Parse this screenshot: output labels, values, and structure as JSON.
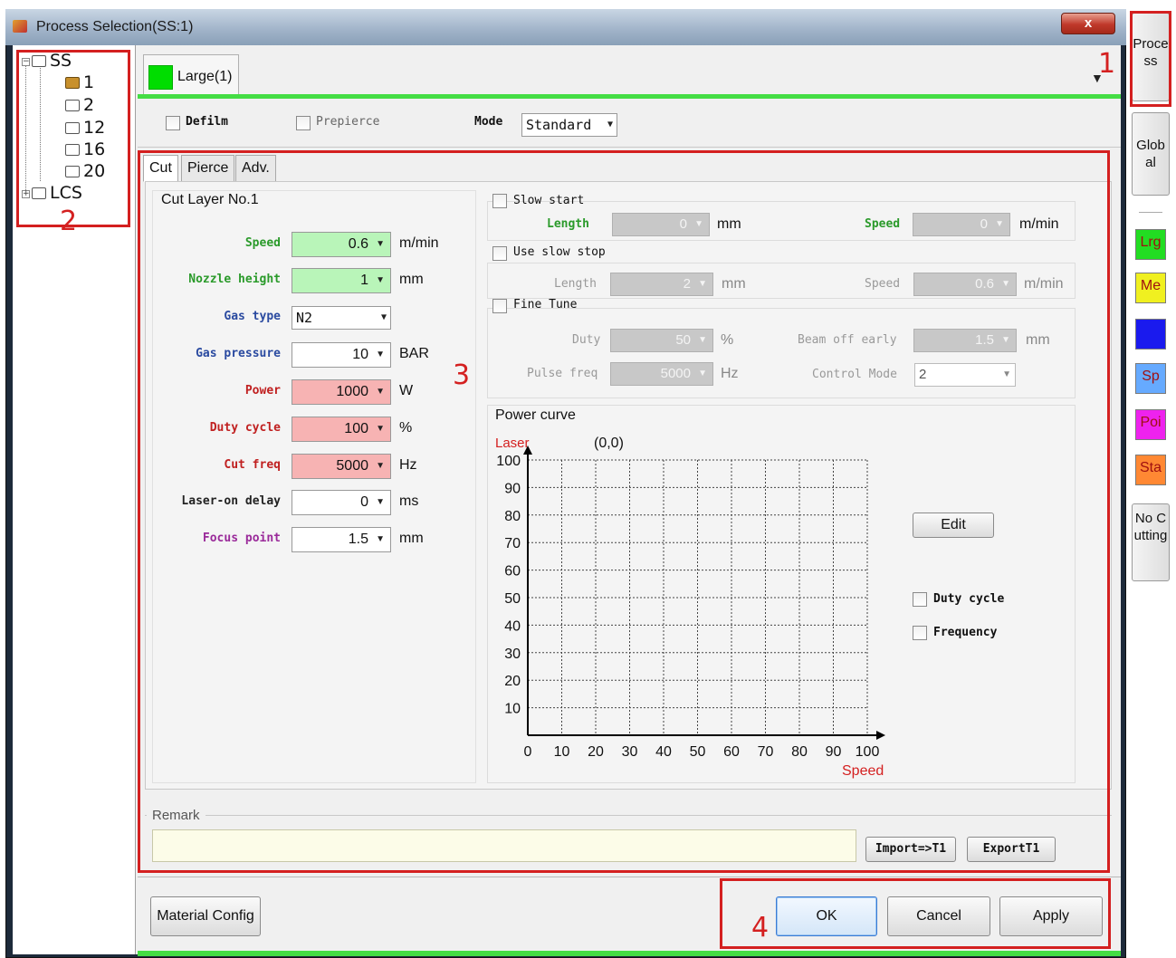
{
  "window": {
    "title": "Process Selection(SS:1)",
    "close_label": "x"
  },
  "tree": {
    "nodes": [
      {
        "label": "SS",
        "expander": "−",
        "expanded": true
      },
      {
        "label": "1",
        "selected": true
      },
      {
        "label": "2"
      },
      {
        "label": "12"
      },
      {
        "label": "16"
      },
      {
        "label": "20"
      },
      {
        "label": "LCS",
        "expander": "+",
        "expanded": false
      }
    ]
  },
  "process_tab": {
    "label": "Large(1)",
    "color": "#00dd00"
  },
  "options": {
    "defilm_label": "Defilm",
    "prepierce_label": "Prepierce",
    "mode_label": "Mode",
    "mode_value": "Standard"
  },
  "subtabs": [
    "Cut",
    "Pierce",
    "Adv."
  ],
  "cut": {
    "layer_title": "Cut Layer No.1",
    "fields": [
      {
        "label": "Speed",
        "value": "0.6",
        "unit": "m/min",
        "label_color": "#2a9a2a",
        "bg": "green"
      },
      {
        "label": "Nozzle height",
        "value": "1",
        "unit": "mm",
        "label_color": "#2a9a2a",
        "bg": "green"
      },
      {
        "label": "Gas pressure",
        "value": "10",
        "unit": "BAR",
        "label_color": "#2a4aa0",
        "bg": "white"
      },
      {
        "label": "Power",
        "value": "1000",
        "unit": "W",
        "label_color": "#c02020",
        "bg": "red"
      },
      {
        "label": "Duty cycle",
        "value": "100",
        "unit": "%",
        "label_color": "#c02020",
        "bg": "red"
      },
      {
        "label": "Cut freq",
        "value": "5000",
        "unit": "Hz",
        "label_color": "#c02020",
        "bg": "red"
      },
      {
        "label": "Laser-on delay",
        "value": "0",
        "unit": "ms",
        "label_color": "#222222",
        "bg": "white"
      },
      {
        "label": "Focus point",
        "value": "1.5",
        "unit": "mm",
        "label_color": "#9a2a9a",
        "bg": "white"
      }
    ],
    "gas_type": {
      "label": "Gas type",
      "value": "N2",
      "label_color": "#2a4aa0"
    }
  },
  "slow": {
    "slow_start_label": "Slow start",
    "start_length_label": "Length",
    "start_length_value": "0",
    "start_length_unit": "mm",
    "start_speed_label": "Speed",
    "start_speed_value": "0",
    "start_speed_unit": "m/min",
    "slow_stop_label": "Use slow stop",
    "stop_length_label": "Length",
    "stop_length_value": "2",
    "stop_length_unit": "mm",
    "stop_speed_label": "Speed",
    "stop_speed_value": "0.6",
    "stop_speed_unit": "m/min"
  },
  "fine_tune": {
    "label": "Fine Tune",
    "duty_label": "Duty",
    "duty_value": "50",
    "duty_unit": "%",
    "beam_off_label": "Beam off early",
    "beam_off_value": "1.5",
    "beam_off_unit": "mm",
    "pulse_label": "Pulse freq",
    "pulse_value": "5000",
    "pulse_unit": "Hz",
    "control_mode_label": "Control Mode",
    "control_mode_value": "2"
  },
  "power_curve": {
    "title": "Power curve",
    "edit_label": "Edit",
    "duty_cycle_label": "Duty cycle",
    "frequency_label": "Frequency"
  },
  "chart_data": {
    "type": "line",
    "title": "",
    "xlabel": "Speed",
    "ylabel": "Laser",
    "origin_label": "(0,0)",
    "xlim": [
      0,
      100
    ],
    "ylim": [
      0,
      100
    ],
    "x_ticks": [
      "0",
      "10",
      "20",
      "30",
      "40",
      "50",
      "60",
      "70",
      "80",
      "90",
      "100"
    ],
    "y_ticks": [
      "10",
      "20",
      "30",
      "40",
      "50",
      "60",
      "70",
      "80",
      "90",
      "100"
    ],
    "grid": true,
    "series": []
  },
  "remark": {
    "label": "Remark",
    "value": "",
    "import_label": "Import=>T1",
    "export_label": "ExportT1"
  },
  "footer": {
    "material_config_label": "Material Config",
    "ok_label": "OK",
    "cancel_label": "Cancel",
    "apply_label": "Apply"
  },
  "side_tabs": {
    "process_label": "Process",
    "global_label": "Global",
    "no_cutting_label": "No Cutting",
    "swatches": [
      {
        "label": "Lrg",
        "color": "#22dd22"
      },
      {
        "label": "Me",
        "color": "#f0f020"
      },
      {
        "label": "",
        "color": "#1a1aee"
      },
      {
        "label": "Sp",
        "color": "#66aaff"
      },
      {
        "label": "Poi",
        "color": "#ee22ee"
      },
      {
        "label": "Sta",
        "color": "#ff8833"
      }
    ]
  },
  "annotations": [
    "1",
    "2",
    "3",
    "4"
  ]
}
